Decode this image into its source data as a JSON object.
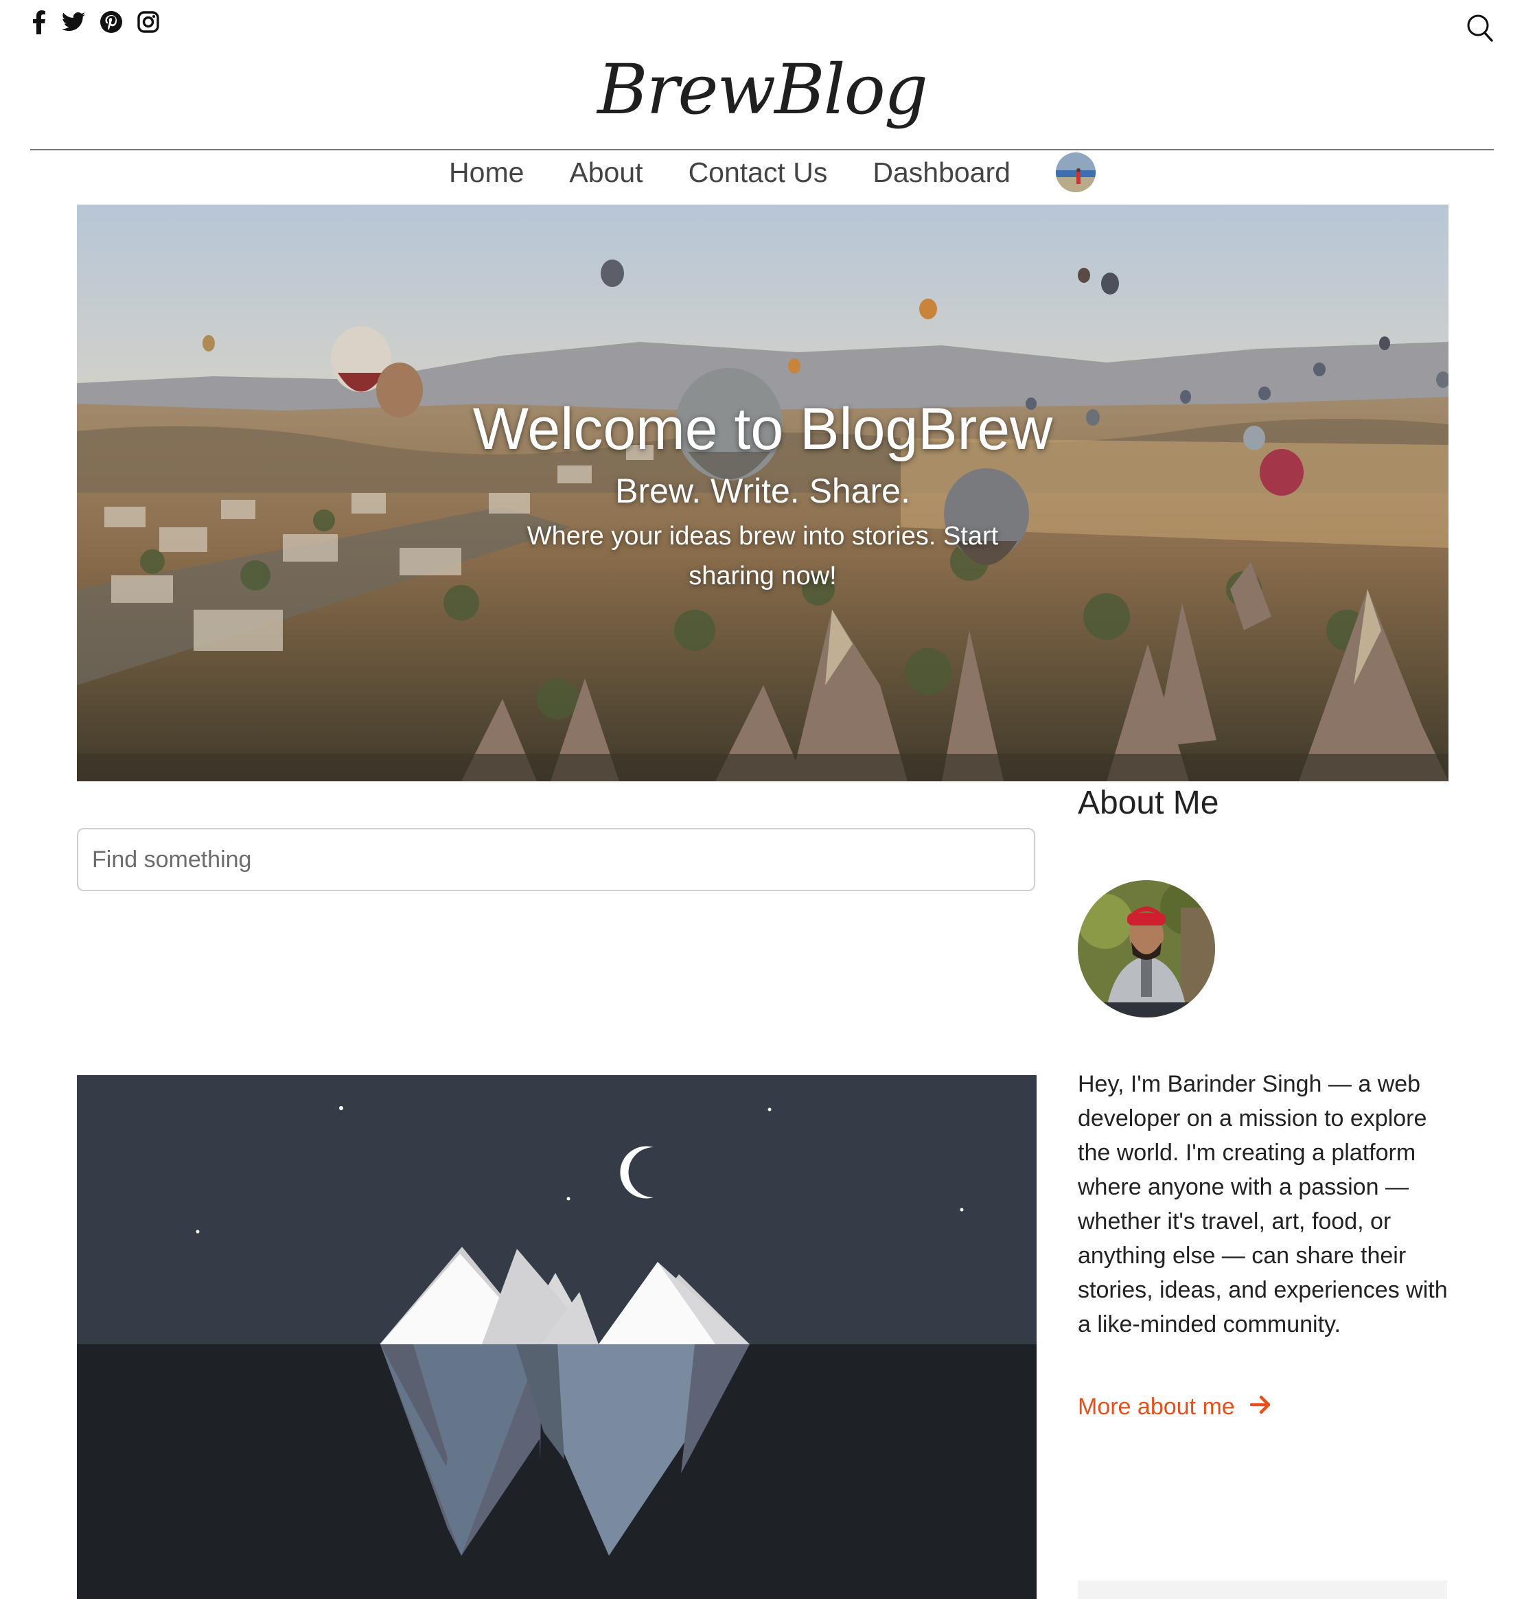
{
  "social": {
    "icons": [
      "facebook-icon",
      "twitter-icon",
      "pinterest-icon",
      "instagram-icon"
    ]
  },
  "header": {
    "logo_text": "BrewBlog",
    "search_icon": "search-icon"
  },
  "nav": {
    "items": [
      {
        "label": "Home"
      },
      {
        "label": "About"
      },
      {
        "label": "Contact Us"
      },
      {
        "label": "Dashboard"
      }
    ]
  },
  "hero": {
    "title": "Welcome to BlogBrew",
    "subtitle": "Brew. Write. Share.",
    "tagline": "Where your ideas brew into stories. Start sharing now!"
  },
  "search": {
    "placeholder": "Find something",
    "value": ""
  },
  "sidebar": {
    "heading": "About Me",
    "bio": "Hey, I'm Barinder Singh — a web developer on a mission to explore the world. I'm creating a platform where anyone with a passion — whether it's travel, art, food, or anything else — can share their stories, ideas, and experiences with a like-minded community.",
    "more_link": "More about me"
  },
  "colors": {
    "accent": "#e8501b",
    "post_sky": "#343c48",
    "post_water": "#1e2227"
  }
}
